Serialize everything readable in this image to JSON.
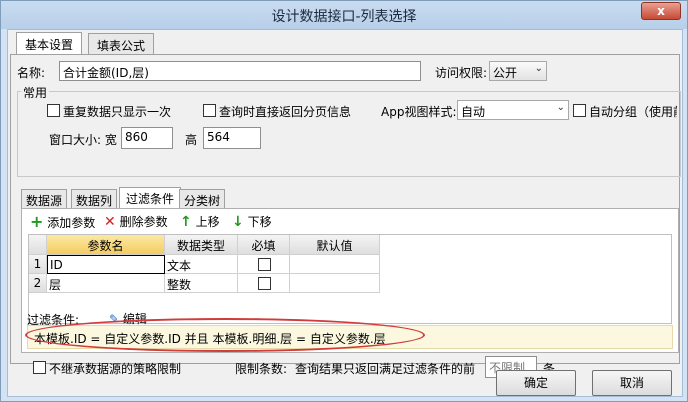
{
  "window": {
    "title": "设计数据接口-列表选择",
    "close_glyph": "x"
  },
  "tabs": [
    {
      "label": "基本设置"
    },
    {
      "label": "填表公式"
    }
  ],
  "name": {
    "label": "名称:",
    "value": "合计金额(ID,层)"
  },
  "access": {
    "label": "访问权限:",
    "value": "公开"
  },
  "common": {
    "group_label": "常用",
    "repeat_label": "重复数据只显示一次",
    "paging_label": "查询时直接返回分页信息",
    "app_view_label": "App视图样式:",
    "app_view_value": "自动",
    "auto_group_label": "自动分组（使用前",
    "size_label": "窗口大小: 宽",
    "width_value": "860",
    "height_label": "高",
    "height_value": "564"
  },
  "inner_tabs": [
    {
      "label": "数据源"
    },
    {
      "label": "数据列"
    },
    {
      "label": "过滤条件"
    },
    {
      "label": "分类树"
    }
  ],
  "toolbar": {
    "add": "添加参数",
    "delete": "删除参数",
    "up": "上移",
    "down": "下移"
  },
  "grid": {
    "headers": [
      "参数名",
      "数据类型",
      "必填",
      "默认值"
    ],
    "rows": [
      {
        "num": "1",
        "name": "ID",
        "type": "文本"
      },
      {
        "num": "2",
        "name": "层",
        "type": "整数"
      }
    ]
  },
  "filter": {
    "label": "过滤条件:",
    "edit_label": "编辑",
    "expression": "本模板.ID = 自定义参数.ID 并且 本模板.明细.层 = 自定义参数.层"
  },
  "bottom": {
    "inherit_label": "不继承数据源的策略限制",
    "limit_label": "限制条数:",
    "limit_desc": "查询结果只返回满足过滤条件的前",
    "limit_value": "不限制",
    "limit_unit": "条"
  },
  "buttons": {
    "ok": "确定",
    "cancel": "取消"
  },
  "colors": {
    "title_bg": "#c9dcf1",
    "close_bg": "#c74a34",
    "highlight": "#f4cc62",
    "ellipse": "#d23b3b"
  }
}
